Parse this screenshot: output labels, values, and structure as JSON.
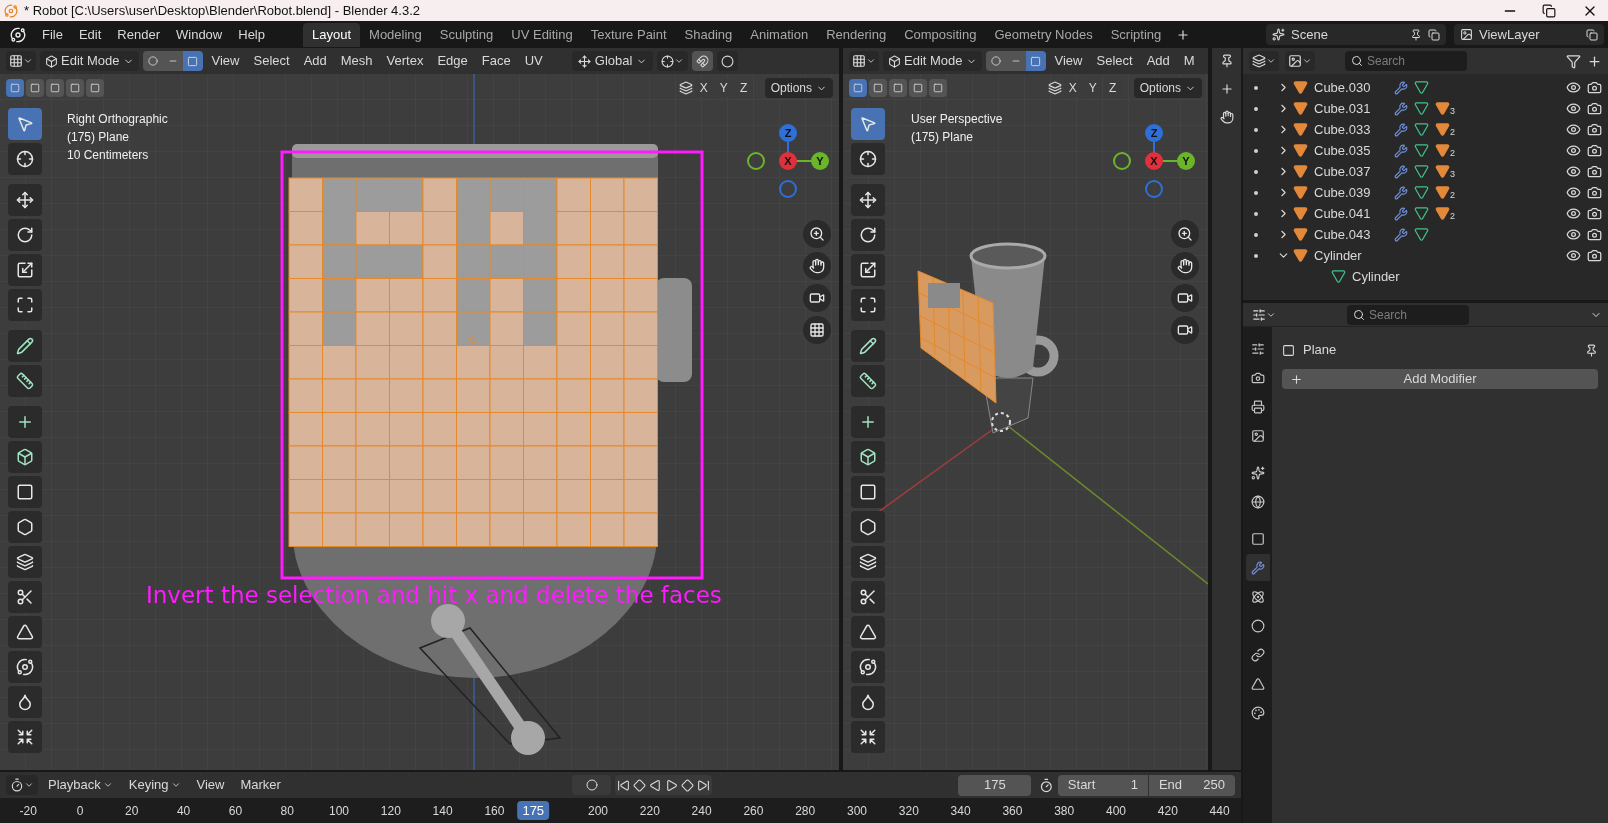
{
  "window": {
    "title": "* Robot [C:\\Users\\user\\Desktop\\Blender\\Robot.blend] - Blender 4.3.2"
  },
  "menu": [
    "File",
    "Edit",
    "Render",
    "Window",
    "Help"
  ],
  "workspaces": [
    {
      "label": "Layout",
      "selected": true
    },
    {
      "label": "Modeling",
      "selected": false
    },
    {
      "label": "Sculpting",
      "selected": false
    },
    {
      "label": "UV Editing",
      "selected": false
    },
    {
      "label": "Texture Paint",
      "selected": false
    },
    {
      "label": "Shading",
      "selected": false
    },
    {
      "label": "Animation",
      "selected": false
    },
    {
      "label": "Rendering",
      "selected": false
    },
    {
      "label": "Compositing",
      "selected": false
    },
    {
      "label": "Geometry Nodes",
      "selected": false
    },
    {
      "label": "Scripting",
      "selected": false
    }
  ],
  "scene": "Scene",
  "view_layer": "ViewLayer",
  "left_viewport": {
    "mode": "Edit Mode",
    "menus": [
      "View",
      "Select",
      "Add",
      "Mesh",
      "Vertex",
      "Edge",
      "Face",
      "UV"
    ],
    "orientation": "Global",
    "axes": [
      "X",
      "Y",
      "Z"
    ],
    "options": "Options",
    "info": [
      "Right Orthographic",
      "(175) Plane",
      "10 Centimeters"
    ],
    "gizmo": [
      "Z",
      "X",
      "Y"
    ],
    "annotation": "Invert the selection and hit x and delete the faces",
    "tools": [
      {
        "kind": "select",
        "selected": true
      },
      {
        "kind": "cursor",
        "selected": false
      },
      {
        "kind": "move",
        "selected": false
      },
      {
        "kind": "rotate",
        "selected": false
      },
      {
        "kind": "scale",
        "selected": false
      },
      {
        "kind": "transform",
        "selected": false
      },
      {
        "kind": "annotate",
        "selected": false
      },
      {
        "kind": "measure",
        "selected": false
      },
      {
        "kind": "add",
        "selected": false
      },
      {
        "kind": "extrude",
        "selected": false
      },
      {
        "kind": "inset",
        "selected": false
      },
      {
        "kind": "bevel",
        "selected": false
      },
      {
        "kind": "loopcut",
        "selected": false
      },
      {
        "kind": "knife",
        "selected": false
      },
      {
        "kind": "polybuild",
        "selected": false
      },
      {
        "kind": "spin",
        "selected": false
      },
      {
        "kind": "smooth",
        "selected": false
      },
      {
        "kind": "shrink",
        "selected": false
      }
    ]
  },
  "right_viewport": {
    "mode": "Edit Mode",
    "menus": [
      "View",
      "Select",
      "Add",
      "M"
    ],
    "axes": [
      "X",
      "Y",
      "Z"
    ],
    "options": "Options",
    "info": [
      "User Perspective",
      "(175) Plane"
    ],
    "gizmo": [
      "Z",
      "X",
      "Y"
    ],
    "tools": [
      {
        "kind": "select",
        "selected": true
      },
      {
        "kind": "cursor",
        "selected": false
      },
      {
        "kind": "move",
        "selected": false
      },
      {
        "kind": "rotate",
        "selected": false
      },
      {
        "kind": "scale",
        "selected": false
      },
      {
        "kind": "transform",
        "selected": false
      },
      {
        "kind": "annotate",
        "selected": false
      },
      {
        "kind": "measure",
        "selected": false
      },
      {
        "kind": "add",
        "selected": false
      },
      {
        "kind": "extrude",
        "selected": false
      },
      {
        "kind": "inset",
        "selected": false
      },
      {
        "kind": "bevel",
        "selected": false
      },
      {
        "kind": "loopcut",
        "selected": false
      },
      {
        "kind": "knife",
        "selected": false
      },
      {
        "kind": "polybuild",
        "selected": false
      },
      {
        "kind": "spin",
        "selected": false
      },
      {
        "kind": "smooth",
        "selected": false
      },
      {
        "kind": "shrink",
        "selected": false
      }
    ]
  },
  "outliner": {
    "search": {
      "placeholder": "Search"
    },
    "items": [
      {
        "name": "Cube.030",
        "kind": "object",
        "expanded": false
      },
      {
        "name": "Cube.031",
        "kind": "object",
        "expanded": false,
        "material_count": "3"
      },
      {
        "name": "Cube.033",
        "kind": "object",
        "expanded": false,
        "material_count": "2"
      },
      {
        "name": "Cube.035",
        "kind": "object",
        "expanded": false,
        "material_count": "2"
      },
      {
        "name": "Cube.037",
        "kind": "object",
        "expanded": false,
        "material_count": "3"
      },
      {
        "name": "Cube.039",
        "kind": "object",
        "expanded": false,
        "material_count": "2"
      },
      {
        "name": "Cube.041",
        "kind": "object",
        "expanded": false,
        "material_count": "2"
      },
      {
        "name": "Cube.043",
        "kind": "object",
        "expanded": false
      },
      {
        "name": "Cylinder",
        "kind": "object",
        "expanded": true,
        "children": [
          {
            "name": "Cylinder",
            "kind": "mesh"
          }
        ]
      }
    ]
  },
  "properties": {
    "search": {
      "placeholder": "Search"
    },
    "object": "Plane",
    "add_modifier": "Add Modifier",
    "tabs": [
      {
        "kind": "tool",
        "selected": false
      },
      {
        "kind": "render",
        "selected": false
      },
      {
        "kind": "output",
        "selected": false
      },
      {
        "kind": "view_layer",
        "selected": false
      },
      {
        "kind": "scene",
        "selected": false
      },
      {
        "kind": "world",
        "selected": false
      },
      {
        "kind": "object",
        "selected": false
      },
      {
        "kind": "modifiers",
        "selected": true
      },
      {
        "kind": "particles",
        "selected": false
      },
      {
        "kind": "physics",
        "selected": false
      },
      {
        "kind": "constraints",
        "selected": false
      },
      {
        "kind": "data",
        "selected": false
      },
      {
        "kind": "material",
        "selected": false
      }
    ]
  },
  "timeline": {
    "menus": [
      "Playback",
      "Keying",
      "View",
      "Marker"
    ],
    "current_frame": "175",
    "start_label": "Start",
    "start": "1",
    "end_label": "End",
    "end": "250",
    "ruler": [
      "-20",
      "0",
      "20",
      "40",
      "60",
      "80",
      "100",
      "120",
      "140",
      "160",
      "200",
      "220",
      "240",
      "260",
      "280",
      "300",
      "320",
      "340",
      "360",
      "380",
      "400",
      "420",
      "440"
    ],
    "playhead": "175"
  }
}
